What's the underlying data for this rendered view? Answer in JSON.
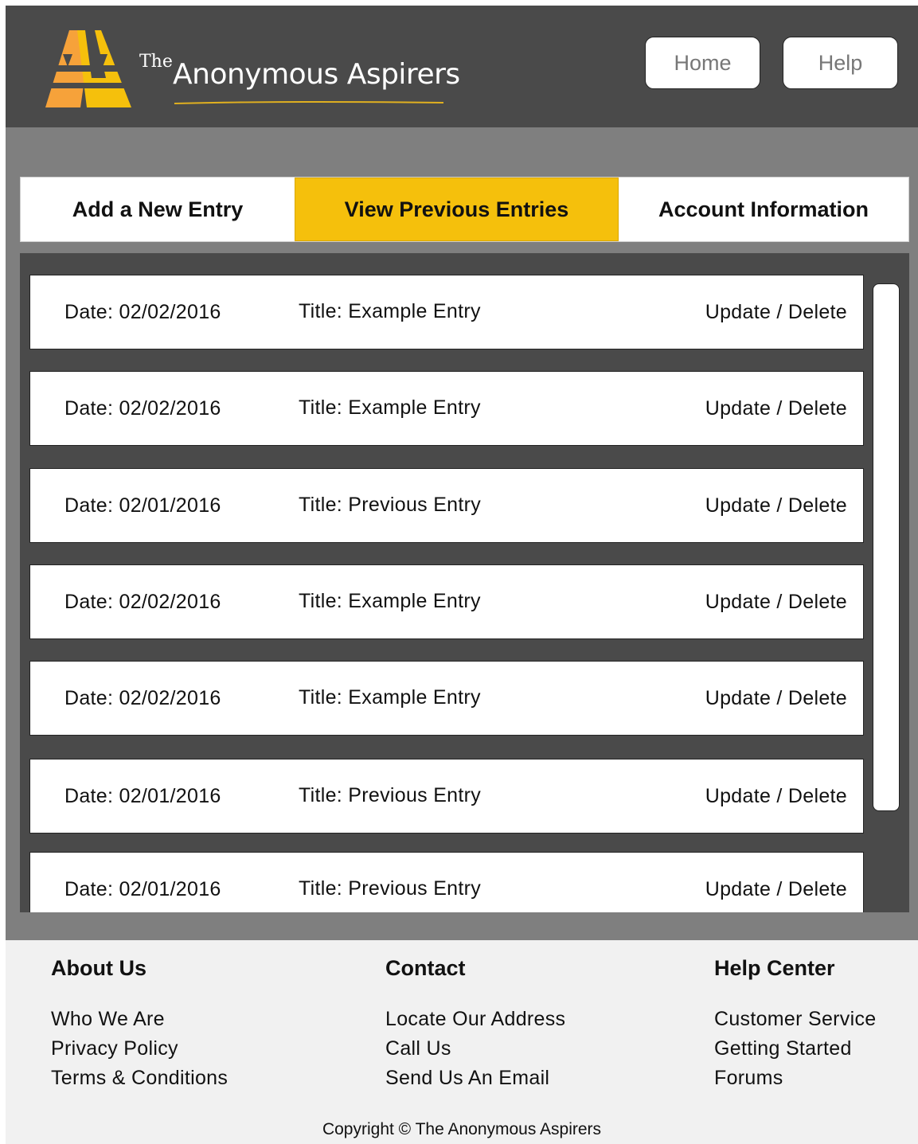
{
  "header": {
    "brand_prefix": "The",
    "brand_name": "Anonymous Aspirers",
    "nav": {
      "home_label": "Home",
      "help_label": "Help"
    },
    "colors": {
      "background": "#4a4a4a",
      "logo_orange": "#f6a23a",
      "logo_yellow": "#f5c00c"
    }
  },
  "tabs": [
    {
      "label": "Add a New Entry",
      "active": false
    },
    {
      "label": "View Previous Entries",
      "active": true
    },
    {
      "label": "Account Information",
      "active": false
    }
  ],
  "entries": [
    {
      "date": "Date: 02/02/2016",
      "title": "Title: Example Entry",
      "update": "Update",
      "sep": "/",
      "delete": "Delete"
    },
    {
      "date": "Date: 02/02/2016",
      "title": "Title: Example Entry",
      "update": "Update",
      "sep": "/",
      "delete": "Delete"
    },
    {
      "date": "Date: 02/01/2016",
      "title": "Title: Previous Entry",
      "update": "Update",
      "sep": "/",
      "delete": "Delete"
    },
    {
      "date": "Date: 02/02/2016",
      "title": "Title: Example Entry",
      "update": "Update",
      "sep": "/",
      "delete": "Delete"
    },
    {
      "date": "Date: 02/02/2016",
      "title": "Title: Example Entry",
      "update": "Update",
      "sep": "/",
      "delete": "Delete"
    },
    {
      "date": "Date: 02/01/2016",
      "title": "Title: Previous Entry",
      "update": "Update",
      "sep": "/",
      "delete": "Delete"
    },
    {
      "date": "Date: 02/01/2016",
      "title": "Title: Previous Entry",
      "update": "Update",
      "sep": "/",
      "delete": "Delete"
    }
  ],
  "footer": {
    "about": {
      "heading": "About Us",
      "links": [
        "Who We Are",
        "Privacy Policy",
        "Terms & Conditions"
      ]
    },
    "contact": {
      "heading": "Contact",
      "links": [
        "Locate Our Address",
        "Call Us",
        "Send Us An Email"
      ]
    },
    "help": {
      "heading": "Help Center",
      "links": [
        "Customer Service",
        "Getting Started",
        "Forums"
      ]
    },
    "copyright": "Copyright © The Anonymous Aspirers"
  },
  "icons": {
    "logo": "double-a-logo-icon"
  }
}
